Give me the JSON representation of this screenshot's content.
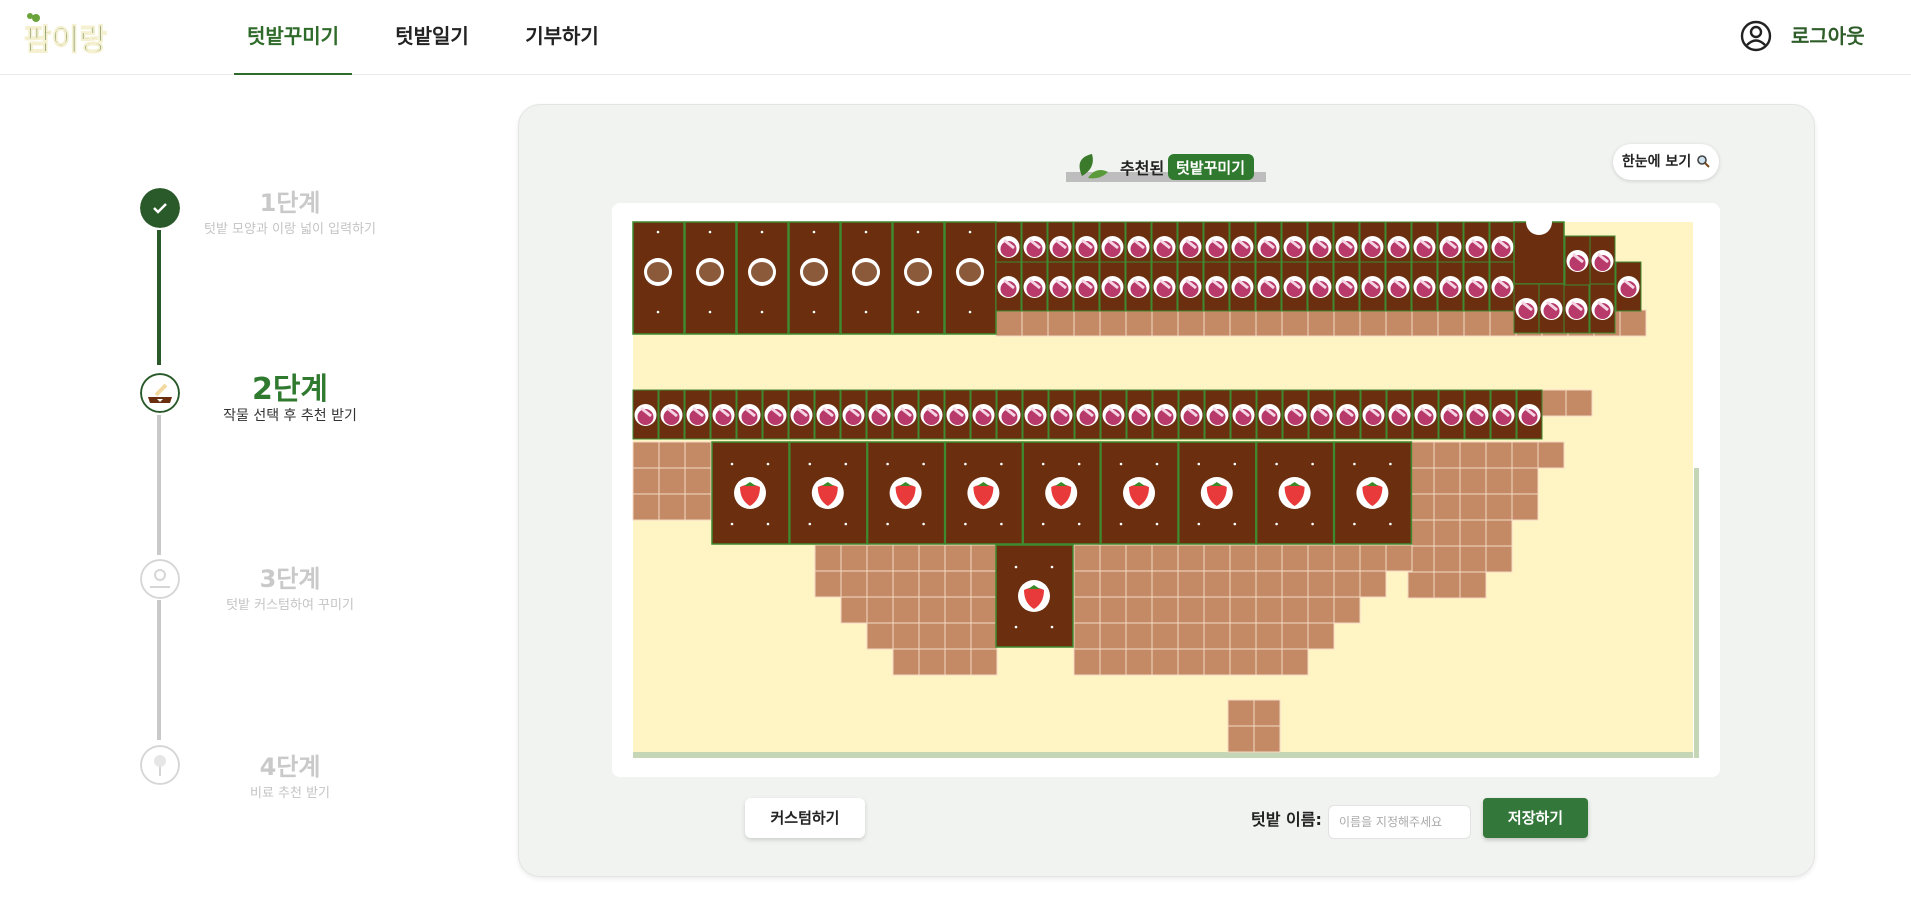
{
  "header": {
    "logo_text": "팜이랑",
    "nav": [
      "텃밭꾸미기",
      "텃밭일기",
      "기부하기"
    ],
    "active_nav": 0,
    "logout_label": "로그아웃"
  },
  "steps": [
    {
      "title": "1단계",
      "desc": "텃밭 모양과 이랑 넓이 입력하기",
      "status": "done"
    },
    {
      "title": "2단계",
      "desc": "작물 선택 후 추천 받기",
      "status": "active"
    },
    {
      "title": "3단계",
      "desc": "텃밭 커스텀하여 꾸미기",
      "status": "pending"
    },
    {
      "title": "4단계",
      "desc": "비료 추천 받기",
      "status": "pending"
    }
  ],
  "main": {
    "title_prefix": "추천된",
    "title_highlight": "텃밭꾸미기",
    "glance_label": "한눈에 보기",
    "custom_label": "커스텀하기",
    "name_label": "텃밭 이름:",
    "name_placeholder": "이름을 지정해주세요",
    "save_label": "저장하기"
  },
  "crops": {
    "potato": "potato-icon",
    "beet": "beet-icon",
    "strawberry": "strawberry-icon"
  },
  "colors": {
    "brand_green": "#2f6b2a",
    "save_green": "#33773a",
    "soil_dark": "#6b2f10",
    "soil_light": "#c48a65",
    "field_bg": "#fff4c4",
    "step_done": "#2a5a2a"
  }
}
